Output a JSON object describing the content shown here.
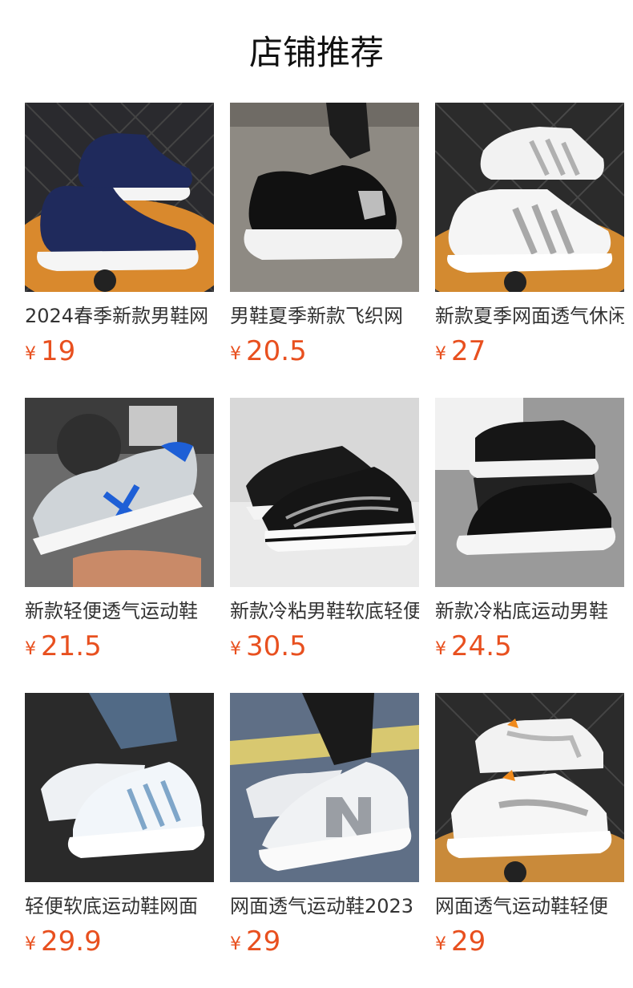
{
  "section_title": "店铺推荐",
  "products": [
    {
      "name": "2024春季新款男鞋网",
      "currency": "¥",
      "price": "19",
      "image": "navy-slip-on-sneakers"
    },
    {
      "name": "男鞋夏季新款飞织网",
      "currency": "¥",
      "price": "20.5",
      "image": "black-sock-sneaker"
    },
    {
      "name": "新款夏季网面透气休闲",
      "currency": "¥",
      "price": "27",
      "image": "white-striped-sneakers"
    },
    {
      "name": "新款轻便透气运动鞋",
      "currency": "¥",
      "price": "21.5",
      "image": "grey-blue-x-sneaker"
    },
    {
      "name": "新款冷粘男鞋软底轻便",
      "currency": "¥",
      "price": "30.5",
      "image": "black-wave-sneakers"
    },
    {
      "name": "新款冷粘底运动男鞋",
      "currency": "¥",
      "price": "24.5",
      "image": "black-knit-sneakers"
    },
    {
      "name": "轻便软底运动鞋网面",
      "currency": "¥",
      "price": "29.9",
      "image": "white-blue-stripe-sneakers"
    },
    {
      "name": "网面透气运动鞋2023",
      "currency": "¥",
      "price": "29",
      "image": "white-n-sneaker"
    },
    {
      "name": "网面透气运动鞋轻便",
      "currency": "¥",
      "price": "29",
      "image": "white-orange-sneakers"
    }
  ],
  "colors": {
    "price": "#e8501f",
    "title": "#111111",
    "name": "#333333"
  }
}
